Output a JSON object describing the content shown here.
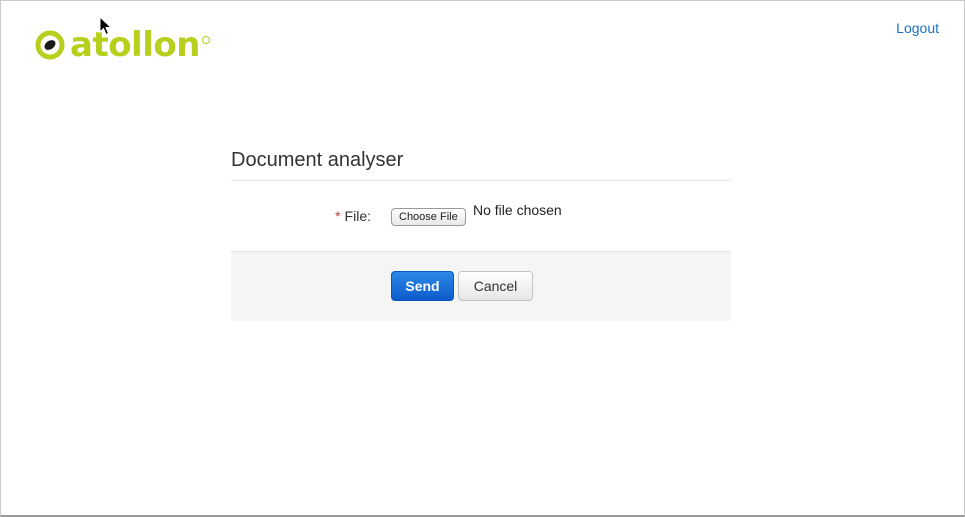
{
  "brand": {
    "name": "atollon",
    "color": "#b7cf1d",
    "icon": "atollon-logo-icon"
  },
  "header": {
    "logout_label": "Logout",
    "link_color": "#1a73c4"
  },
  "form": {
    "title": "Document analyser",
    "file_field": {
      "required_marker": "*",
      "label": "File:",
      "button_label": "Choose File",
      "status": "No file chosen"
    },
    "actions": {
      "send_label": "Send",
      "cancel_label": "Cancel",
      "primary_color": "#0d5ccc"
    }
  },
  "pointer": {
    "icon": "mouse-pointer-icon"
  }
}
